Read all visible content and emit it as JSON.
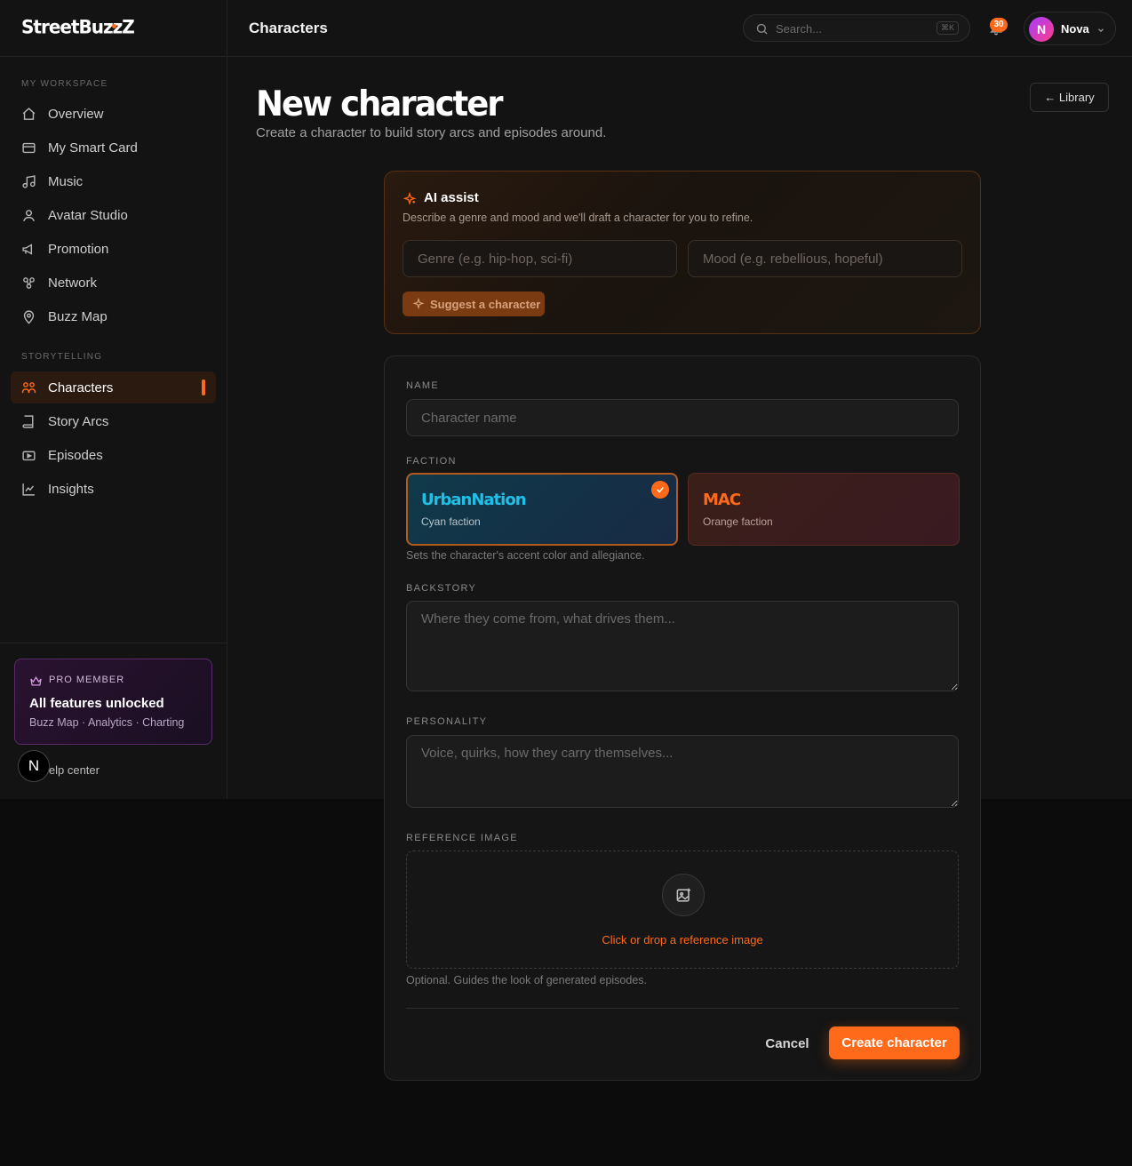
{
  "brand": {
    "name": "StreetBuzzZ"
  },
  "header": {
    "title": "Characters",
    "search_placeholder": "Search...",
    "search_shortcut": "⌘K",
    "notifications_count": "30",
    "user": {
      "initial": "N",
      "name": "Nova"
    }
  },
  "sidebar": {
    "workspace_label": "MY WORKSPACE",
    "workspace_items": [
      {
        "label": "Overview",
        "icon": "home-icon"
      },
      {
        "label": "My Smart Card",
        "icon": "card-icon"
      },
      {
        "label": "Music",
        "icon": "music-icon"
      },
      {
        "label": "Avatar Studio",
        "icon": "user-icon"
      },
      {
        "label": "Promotion",
        "icon": "megaphone-icon"
      },
      {
        "label": "Network",
        "icon": "network-icon"
      },
      {
        "label": "Buzz Map",
        "icon": "map-pin-icon"
      }
    ],
    "storytelling_label": "STORYTELLING",
    "storytelling_items": [
      {
        "label": "Characters",
        "icon": "characters-icon",
        "active": true
      },
      {
        "label": "Story Arcs",
        "icon": "book-icon"
      },
      {
        "label": "Episodes",
        "icon": "video-icon"
      },
      {
        "label": "Insights",
        "icon": "chart-icon"
      }
    ],
    "pro": {
      "label": "PRO MEMBER",
      "title": "All features unlocked",
      "subtitle": "Buzz Map · Analytics · Charting"
    },
    "help_label": "lelp center",
    "help_badge": "N"
  },
  "page": {
    "title": "New character",
    "subtitle": "Create a character to build story arcs and episodes around.",
    "library_button": "← Library"
  },
  "ai_assist": {
    "title": "AI assist",
    "description": "Describe a genre and mood and we'll draft a character for you to refine.",
    "genre_placeholder": "Genre (e.g. hip-hop, sci-fi)",
    "mood_placeholder": "Mood (e.g. rebellious, hopeful)",
    "suggest_button": "Suggest a character"
  },
  "form": {
    "name_label": "NAME",
    "name_placeholder": "Character name",
    "faction_label": "FACTION",
    "factions": [
      {
        "name": "UrbanNation",
        "subtitle": "Cyan faction",
        "selected": true
      },
      {
        "name": "MAC",
        "subtitle": "Orange faction",
        "selected": false
      }
    ],
    "faction_hint": "Sets the character's accent color and allegiance.",
    "backstory_label": "BACKSTORY",
    "backstory_placeholder": "Where they come from, what drives them...",
    "personality_label": "PERSONALITY",
    "personality_placeholder": "Voice, quirks, how they carry themselves...",
    "reference_label": "REFERENCE IMAGE",
    "reference_cta": "Click or drop a reference image",
    "reference_hint": "Optional. Guides the look of generated episodes.",
    "cancel_button": "Cancel",
    "create_button": "Create character"
  },
  "colors": {
    "accent": "#ff6a1a",
    "cyan_faction": "#1fc0e8",
    "background": "#131313"
  }
}
